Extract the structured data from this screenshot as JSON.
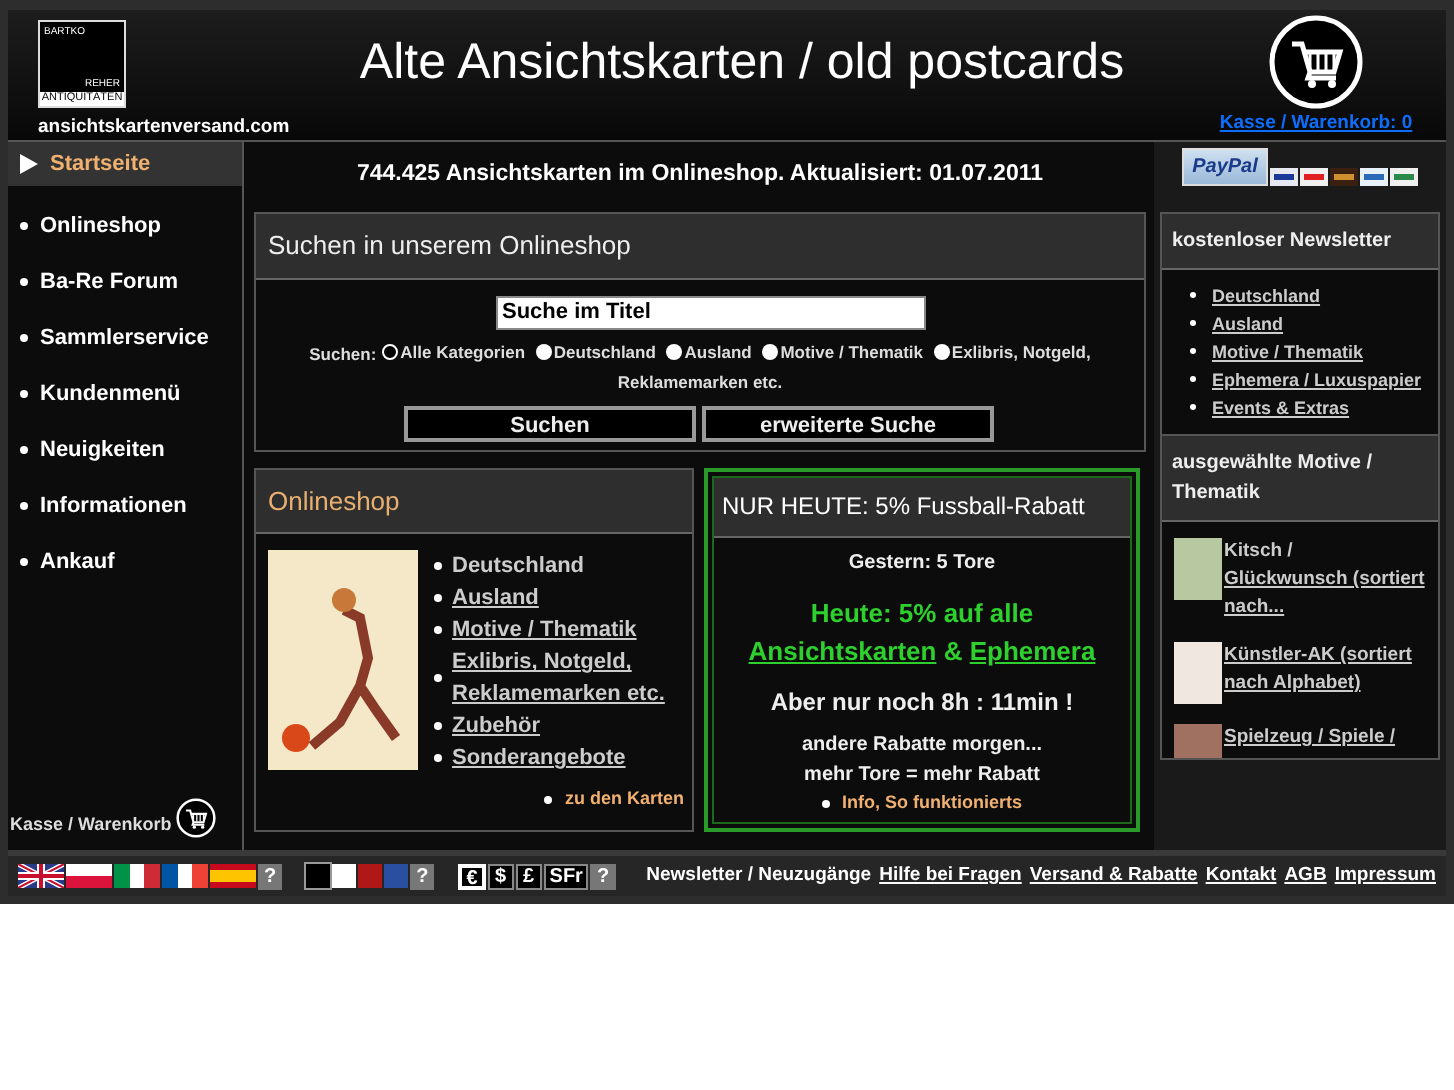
{
  "header": {
    "logo_lines": [
      "BARTKO",
      "REHER",
      "ANTIQUITÄTEN"
    ],
    "site": "ansichtskartenversand.com",
    "title": "Alte Ansichtskarten / old postcards",
    "cart": "Kasse / Warenkorb: 0"
  },
  "nav": [
    {
      "label": "Startseite",
      "selected": true
    },
    {
      "label": "Onlineshop",
      "selected": false
    },
    {
      "label": "Ba-Re Forum",
      "selected": false
    },
    {
      "label": "Sammlerservice",
      "selected": false
    },
    {
      "label": "Kundenmenü",
      "selected": false
    },
    {
      "label": "Neuigkeiten",
      "selected": false
    },
    {
      "label": "Informationen",
      "selected": false
    },
    {
      "label": "Ankauf",
      "selected": false
    }
  ],
  "sidebar_cart": "Kasse / Warenkorb",
  "headline": "744.425 Ansichtskarten im Onlineshop. Aktualisiert: 01.07.2011",
  "payment": {
    "paypal": "PayPal"
  },
  "search": {
    "title": "Suchen in unserem Onlineshop",
    "value": "Suche im Titel",
    "label": "Suchen:",
    "options": [
      {
        "label": "Alle Kategorien",
        "selected": true
      },
      {
        "label": "Deutschland",
        "selected": false
      },
      {
        "label": "Ausland",
        "selected": false
      },
      {
        "label": "Motive / Thematik",
        "selected": false
      },
      {
        "label": "Exlibris, Notgeld, Reklamemarken etc.",
        "selected": false
      }
    ],
    "buttons": [
      "Suchen",
      "erweiterte Suche"
    ]
  },
  "onlineshop": {
    "title": "Onlineshop",
    "items": [
      {
        "label": "Deutschland",
        "link": false
      },
      {
        "label": "Ausland",
        "link": true
      },
      {
        "label": "Motive / Thematik",
        "link": true
      },
      {
        "label": "Exlibris, Notgeld, Reklamemarken etc.",
        "link": true
      },
      {
        "label": "Zubehör",
        "link": true
      },
      {
        "label": "Sonderangebote",
        "link": true
      }
    ],
    "more": "zu den Karten"
  },
  "promo": {
    "title": "NUR HEUTE: 5% Fussball-Rabatt",
    "yesterday": "Gestern: 5 Tore",
    "offer": "Heute: 5% auf alle",
    "offer_links": [
      "Ansichtskarten",
      "Ephemera"
    ],
    "offer_joiner": "&",
    "countdown": "Aber nur noch 8h : 11min !",
    "note1": "andere Rabatte morgen...",
    "note2": "mehr Tore = mehr Rabatt",
    "info": "Info, So funktionierts"
  },
  "newsletter": {
    "title": "kostenloser Newsletter",
    "items": [
      "Deutschland",
      "Ausland",
      "Motive / Thematik",
      "Ephemera / Luxuspapier",
      "Events & Extras"
    ]
  },
  "motive": {
    "title": "ausgewählte Motive / Thematik",
    "items": [
      {
        "prefix": "Kitsch /",
        "label": "Glückwunsch (sortiert nach..."
      },
      {
        "label": "Künstler-AK (sortiert nach Alphabet)"
      },
      {
        "label": "Spielzeug / Spiele /"
      }
    ]
  },
  "footer": {
    "help": "?",
    "colors": [
      {
        "color": "#000000",
        "selected": true
      },
      {
        "color": "#ffffff",
        "selected": false
      },
      {
        "color": "#b01818",
        "selected": false
      },
      {
        "color": "#2a4fa0",
        "selected": false
      }
    ],
    "currencies": [
      {
        "label": "€",
        "selected": true
      },
      {
        "label": "$",
        "selected": false
      },
      {
        "label": "£",
        "selected": false
      },
      {
        "label": "SFr",
        "selected": false
      }
    ],
    "newsletter": "Newsletter / Neuzugänge",
    "links": [
      "Hilfe bei Fragen",
      "Versand & Rabatte",
      "Kontakt",
      "AGB",
      "Impressum"
    ]
  }
}
